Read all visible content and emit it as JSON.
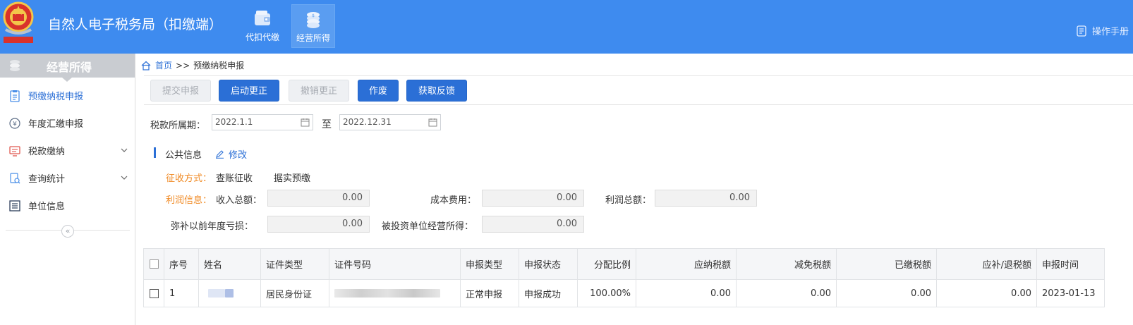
{
  "header": {
    "title": "自然人电子税务局（扣缴端）",
    "nav": [
      {
        "label": "代扣代缴",
        "icon": "wallet-icon"
      },
      {
        "label": "经营所得",
        "icon": "coins-icon"
      }
    ],
    "manual_label": "操作手册"
  },
  "sidebar": {
    "title": "经营所得",
    "items": [
      {
        "label": "预缴纳税申报",
        "icon": "clipboard-icon",
        "active": true
      },
      {
        "label": "年度汇缴申报",
        "icon": "yen-icon"
      },
      {
        "label": "税款缴纳",
        "icon": "monitor-icon"
      },
      {
        "label": "查询统计",
        "icon": "search-doc-icon"
      },
      {
        "label": "单位信息",
        "icon": "list-icon"
      }
    ],
    "collapse_glyph": "«"
  },
  "breadcrumb": {
    "home": "首页",
    "sep": ">>",
    "current": "预缴纳税申报"
  },
  "toolbar": {
    "submit": "提交申报",
    "start_correction": "启动更正",
    "cancel_correction": "撤销更正",
    "void": "作废",
    "feedback": "获取反馈"
  },
  "period": {
    "label": "税款所属期：",
    "start": "2022.1.1",
    "to": "至",
    "end": "2022.12.31"
  },
  "public_info": {
    "title": "公共信息",
    "edit": "修改",
    "collection_label": "征收方式：",
    "collection_value": "查账征收",
    "prepay_value": "据实预缴",
    "profit_label": "利润信息：",
    "income_label": "收入总额：",
    "income_value": "0.00",
    "cost_label": "成本费用：",
    "cost_value": "0.00",
    "profit_total_label": "利润总额：",
    "profit_total_value": "0.00",
    "loss_label": "弥补以前年度亏损：",
    "loss_value": "0.00",
    "invested_label": "被投资单位经营所得：",
    "invested_value": "0.00"
  },
  "table": {
    "headers": [
      "序号",
      "姓名",
      "证件类型",
      "证件号码",
      "申报类型",
      "申报状态",
      "分配比例",
      "应纳税额",
      "减免税额",
      "已缴税额",
      "应补/退税额",
      "申报时间"
    ],
    "rows": [
      {
        "index": "1",
        "id_type": "居民身份证",
        "report_type": "正常申报",
        "status": "申报成功",
        "ratio": "100.00%",
        "tax_payable": "0.00",
        "tax_relief": "0.00",
        "tax_paid": "0.00",
        "tax_due": "0.00",
        "date": "2023-01-13"
      }
    ]
  },
  "colors": {
    "header_bg": "#3e8bef",
    "primary": "#2b6fd6",
    "orange": "#f08a24"
  }
}
